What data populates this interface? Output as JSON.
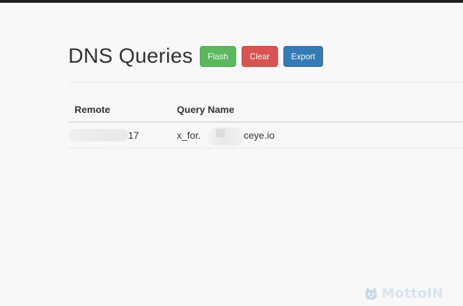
{
  "page": {
    "title": "DNS Queries",
    "buttons": {
      "flash": "Flash",
      "clear": "Clear",
      "export": "Export"
    }
  },
  "table": {
    "headers": {
      "remote": "Remote",
      "query_name": "Query Name"
    },
    "rows": [
      {
        "remote_visible": "17",
        "query_prefix": "x_for.",
        "query_suffix": "ceye.io"
      }
    ]
  },
  "watermark": {
    "text": "MottoIN",
    "icon": "cat-icon"
  },
  "colors": {
    "flash": "#5cb85c",
    "clear": "#d9534f",
    "export": "#337ab7",
    "background": "#f8f8f9",
    "topbar": "#1f1f1f",
    "watermark": "#d7e5f1"
  }
}
